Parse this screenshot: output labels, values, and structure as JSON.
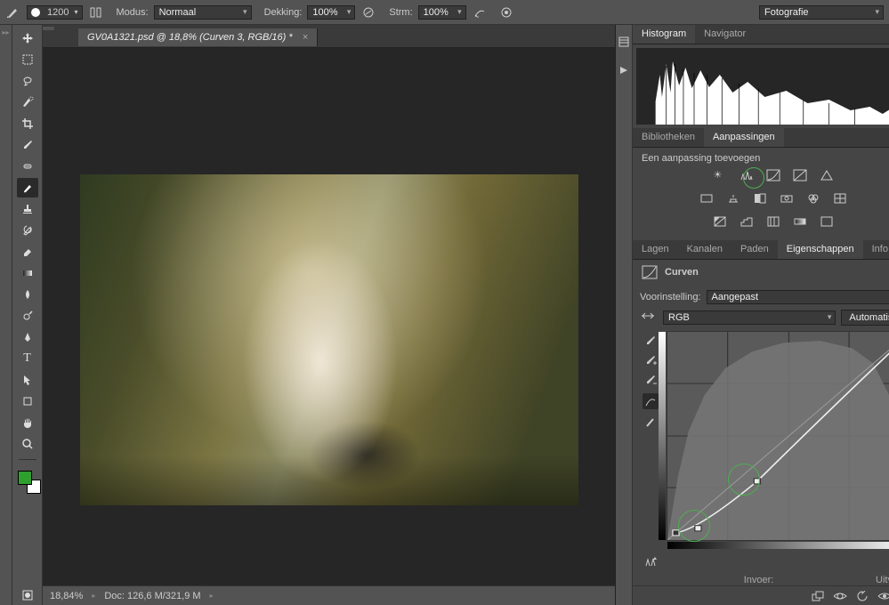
{
  "optionsBar": {
    "brushSize": "1200",
    "modeLabel": "Modus:",
    "modeValue": "Normaal",
    "opacityLabel": "Dekking:",
    "opacityValue": "100%",
    "flowLabel": "Strm:",
    "flowValue": "100%",
    "workspace": "Fotografie"
  },
  "document": {
    "tabTitle": "GV0A1321.psd @ 18,8% (Curven 3, RGB/16) *"
  },
  "status": {
    "zoom": "18,84%",
    "docSize": "Doc: 126,6 M/321,9 M"
  },
  "panels": {
    "histogram": {
      "tabHistogram": "Histogram",
      "tabNavigator": "Navigator"
    },
    "libraries": {
      "tab": "Bibliotheken"
    },
    "adjustments": {
      "tab": "Aanpassingen",
      "addLabel": "Een aanpassing toevoegen"
    },
    "layers": {
      "tab": "Lagen"
    },
    "channels": {
      "tab": "Kanalen"
    },
    "paths": {
      "tab": "Paden"
    },
    "properties": {
      "tab": "Eigenschappen"
    },
    "info": {
      "tab": "Info"
    }
  },
  "curves": {
    "title": "Curven",
    "presetLabel": "Voorinstelling:",
    "presetValue": "Aangepast",
    "channelValue": "RGB",
    "autoButton": "Automatisch",
    "inputLabel": "Invoer:",
    "outputLabel": "Uitvoer:"
  }
}
